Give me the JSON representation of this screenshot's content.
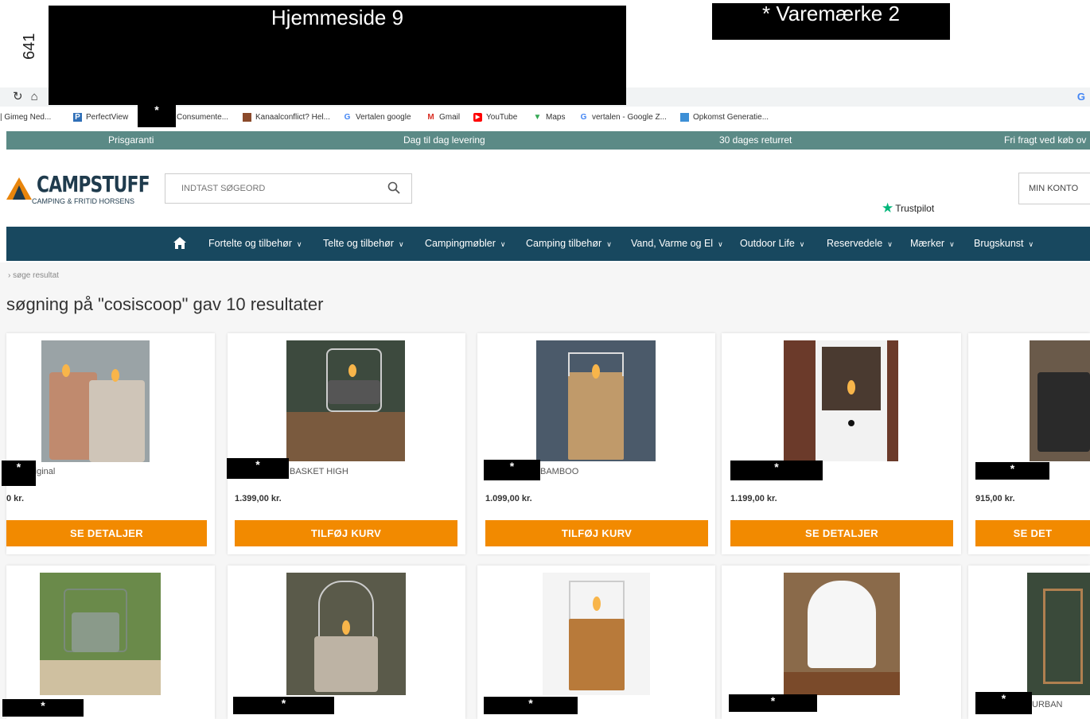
{
  "overlay": {
    "page_label": "Hjemmeside 9",
    "brand_label": "* Varemærke 2",
    "side_number": "641",
    "marker": "*"
  },
  "browser": {
    "reload_icon": "reload-icon",
    "home_icon": "home-icon",
    "google_icon_text": "G",
    "bookmarks": [
      {
        "label": "| Gimeg Ned...",
        "icon": "bookmark-icon",
        "color": "#888888"
      },
      {
        "label": "PerfectView",
        "icon": "P",
        "color": "#2f6fb7"
      },
      {
        "label": "Consumente...",
        "icon": "bookmark-icon",
        "color": "#888888"
      },
      {
        "label": "Kanaalconflict? Hel...",
        "icon": "bookmark-icon",
        "color": "#8b4a2b"
      },
      {
        "label": "Vertalen google",
        "icon": "G",
        "color": "#4285f4"
      },
      {
        "label": "Gmail",
        "icon": "M",
        "color": "#d93025"
      },
      {
        "label": "YouTube",
        "icon": "▶",
        "color": "#ff0000"
      },
      {
        "label": "Maps",
        "icon": "📍",
        "color": "#34a853"
      },
      {
        "label": "vertalen - Google Z...",
        "icon": "G",
        "color": "#4285f4"
      },
      {
        "label": "Opkomst Generatie...",
        "icon": "bookmark-icon",
        "color": "#3d8fd6"
      }
    ]
  },
  "promo": {
    "items": [
      "Prisgaranti",
      "Dag til dag levering",
      "30 dages returret",
      "Fri fragt ved køb ov"
    ]
  },
  "header": {
    "logo_text": "CAMPSTUFF",
    "logo_sub": "CAMPING & FRITID HORSENS",
    "search_placeholder": "INDTAST SØGEORD",
    "trustpilot": "Trustpilot",
    "account": "MIN KONTO"
  },
  "nav": {
    "items": [
      "Fortelte og tilbehør",
      "Telte og tilbehør",
      "Campingmøbler",
      "Camping tilbehør",
      "Vand, Varme og El",
      "Outdoor Life",
      "Reservedele",
      "Mærker",
      "Brugskunst"
    ]
  },
  "breadcrumb": "›   søge resultat",
  "heading": "søgning på \"cosiscoop\" gav 10 resultater",
  "products": [
    {
      "name": "riginal",
      "price": "0 kr.",
      "button": "SE DETALJER"
    },
    {
      "name": "BASKET HIGH",
      "price": "1.399,00 kr.",
      "button": "TILFØJ KURV"
    },
    {
      "name": "BAMBOO",
      "price": "1.099,00 kr.",
      "button": "TILFØJ KURV"
    },
    {
      "name": "",
      "price": "1.199,00 kr.",
      "button": "SE DETALJER"
    },
    {
      "name": "",
      "price": "915,00 kr.",
      "button": "SE DET"
    },
    {
      "name": "",
      "price": "",
      "button": ""
    },
    {
      "name": "",
      "price": "",
      "button": ""
    },
    {
      "name": "",
      "price": "",
      "button": ""
    },
    {
      "name": "",
      "price": "",
      "button": ""
    },
    {
      "name": "URBAN",
      "price": "",
      "button": ""
    }
  ],
  "colors": {
    "promo": "#5b8a86",
    "nav": "#18485f",
    "button": "#f28a00",
    "logo": "#1f3b4d"
  }
}
